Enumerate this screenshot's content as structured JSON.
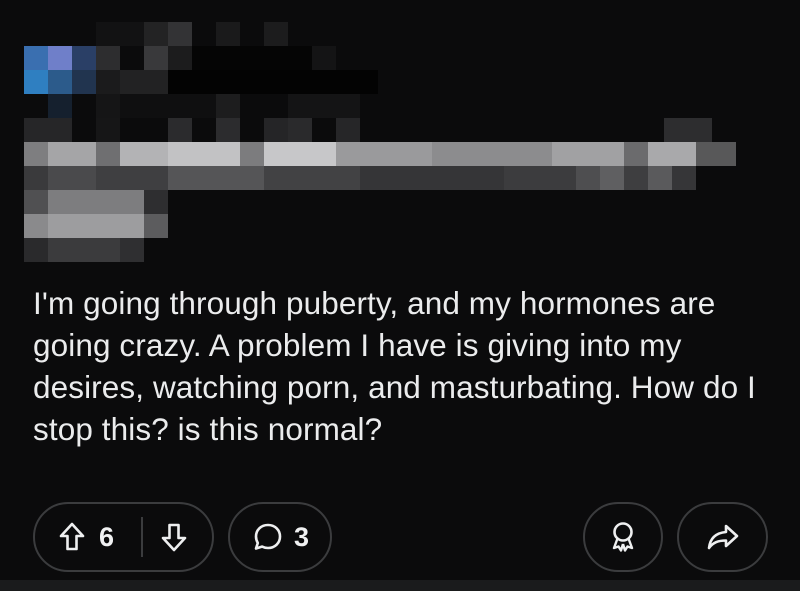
{
  "post": {
    "body": "I'm going through puberty, and my hormones are going crazy. A problem I have is giving into my desires, watching porn, and masturbating. How do I stop this? is this normal?"
  },
  "actions": {
    "score": "6",
    "comment_count": "3",
    "upvote_icon": "arrow-up-icon",
    "downvote_icon": "arrow-down-icon",
    "comment_icon": "speech-bubble-icon",
    "award_icon": "award-icon",
    "share_icon": "share-arrow-icon"
  },
  "colors": {
    "background": "#0b0b0c",
    "text": "#ebeced",
    "pill_border": "#3b3c3e",
    "avatar_blue": "#2f7fc1"
  }
}
